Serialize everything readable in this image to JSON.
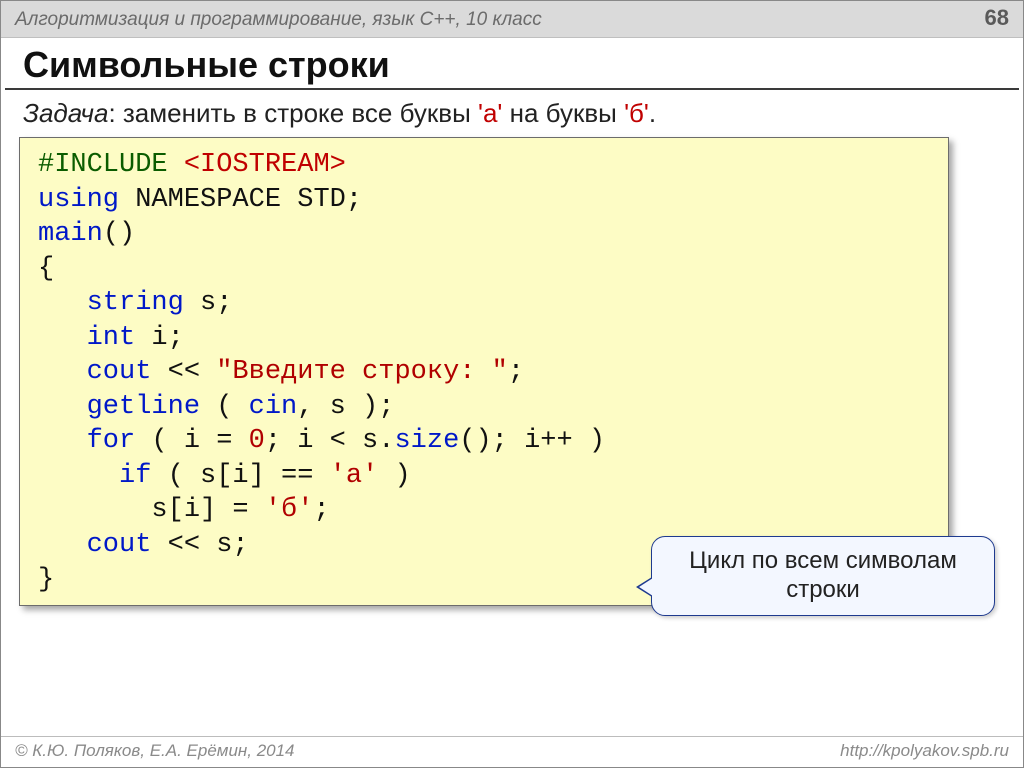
{
  "header": {
    "course": "Алгоритмизация и программирование, язык С++, 10 класс",
    "page": "68"
  },
  "title": "Символьные строки",
  "task": {
    "label": "Задача",
    "before": ": заменить в строке все буквы ",
    "char1": "'а'",
    "mid": " на буквы ",
    "char2": "'б'",
    "after": "."
  },
  "code": {
    "l01a": "#INCLUDE ",
    "l01b": "<IOSTREAM>",
    "l02a": "using",
    "l02b": " NAMESPACE STD",
    "l02c": ";",
    "l03a": "main",
    "l03b": "()",
    "l04": "{",
    "l05a": "   string",
    "l05b": " s;",
    "l06a": "   int",
    "l06b": " i;",
    "l07a": "   cout",
    "l07b": " << ",
    "l07c": "\"Введите строку: \"",
    "l07d": ";",
    "l08a": "   getline",
    "l08b": " ( ",
    "l08c": "cin",
    "l08d": ", s );",
    "l09a": "   for",
    "l09b": " ( i = ",
    "l09c": "0",
    "l09d": "; i < s.",
    "l09e": "size",
    "l09f": "(); i++ )",
    "l10a": "     if",
    "l10b": " ( s[i] == ",
    "l10c": "'а'",
    "l10d": " )",
    "l11a": "       s[i] = ",
    "l11b": "'б'",
    "l11c": ";",
    "l12a": "   cout",
    "l12b": " << s;",
    "l13": "}"
  },
  "callout": "Цикл по всем символам строки",
  "footer": {
    "left": "© К.Ю. Поляков, Е.А. Ерёмин, 2014",
    "right": "http://kpolyakov.spb.ru"
  }
}
